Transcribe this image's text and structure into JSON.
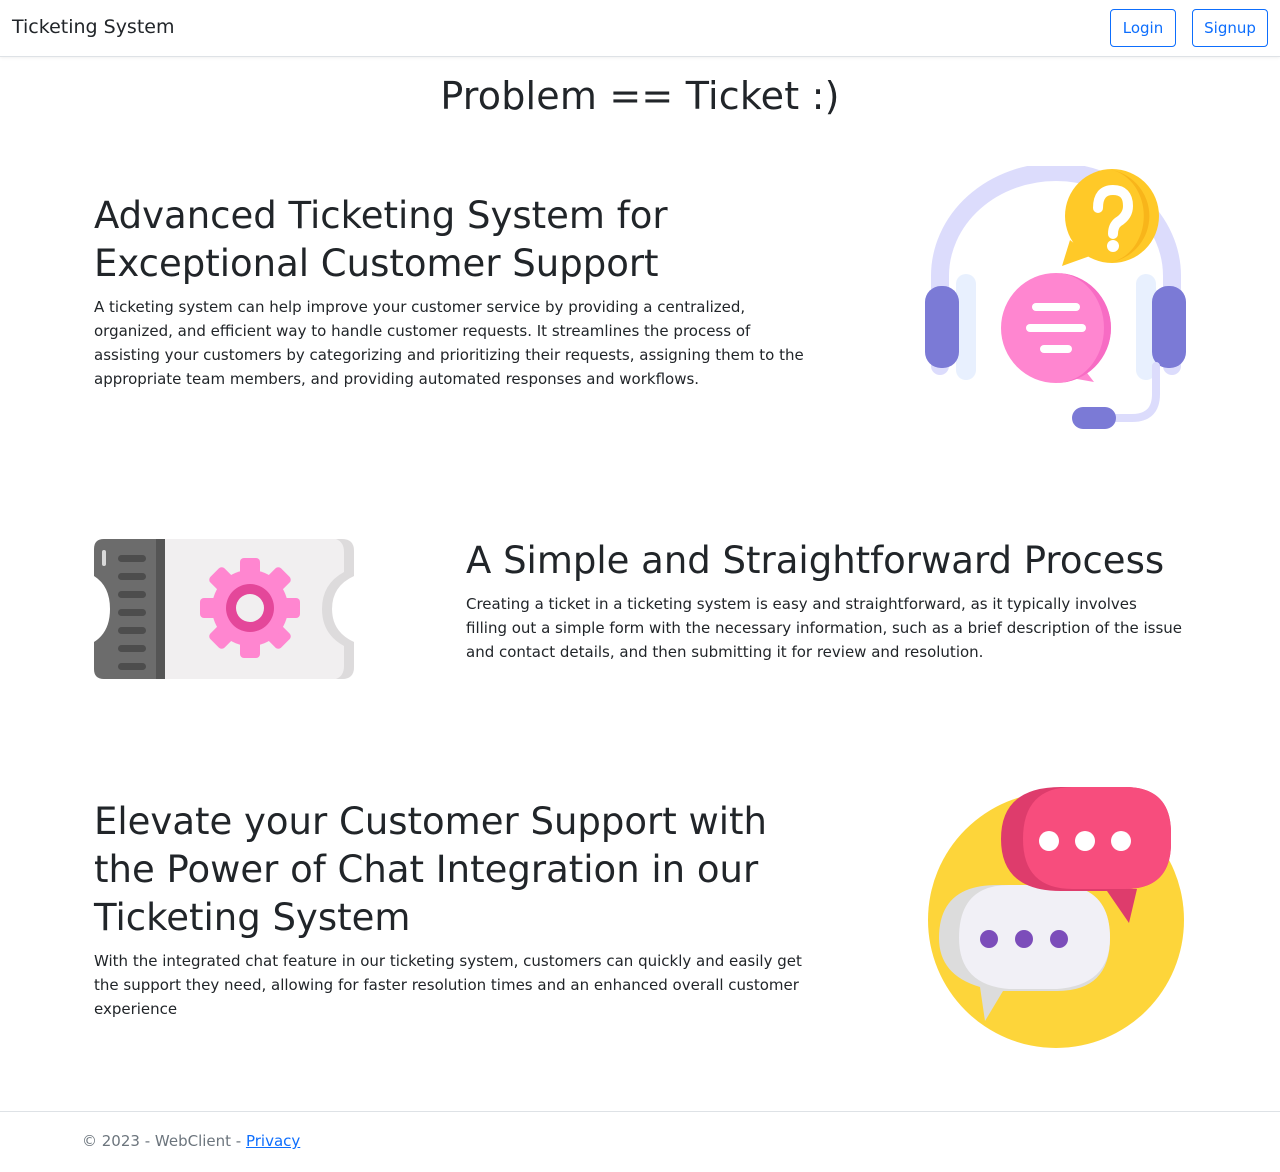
{
  "navbar": {
    "brand": "Ticketing System",
    "login_label": "Login",
    "signup_label": "Signup"
  },
  "hero": {
    "title": "Problem == Ticket :)"
  },
  "sections": [
    {
      "title": "Advanced Ticketing System for Exceptional Customer Support",
      "text": "A ticketing system can help improve your customer service by providing a centralized, organized, and efficient way to handle customer requests. It streamlines the process of assisting your customers by categorizing and prioritizing their requests, assigning them to the appropriate team members, and providing automated responses and workflows.",
      "icon": "headset-support-icon"
    },
    {
      "title": "A Simple and Straightforward Process",
      "text": "Creating a ticket in a ticketing system is easy and straightforward, as it typically involves filling out a simple form with the necessary information, such as a brief description of the issue and contact details, and then submitting it for review and resolution.",
      "icon": "ticket-gear-icon"
    },
    {
      "title": "Elevate your Customer Support with the Power of Chat Integration in our Ticketing System",
      "text": "With the integrated chat feature in our ticketing system, customers can quickly and easily get the support they need, allowing for faster resolution times and an enhanced overall customer experience",
      "icon": "chat-bubbles-icon"
    }
  ],
  "footer": {
    "copyright": "© 2023 - WebClient - ",
    "privacy_label": "Privacy"
  },
  "colors": {
    "primary": "#0d6efd",
    "text": "#212529",
    "muted": "#6c757d"
  }
}
